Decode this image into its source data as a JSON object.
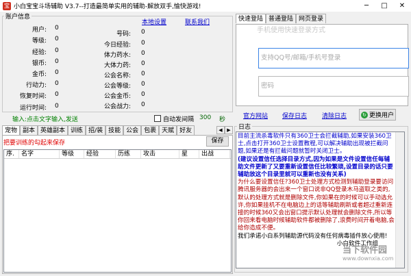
{
  "app": {
    "title": "小白宝宝斗场辅助 V3.7--打造最简单实用的辅助-解放双手,愉快游戏!",
    "icon_glyph": "宝"
  },
  "window_controls": {
    "min": "─",
    "max": "□",
    "close": "✕"
  },
  "account": {
    "legend": "账户信息",
    "links": {
      "local_settings": "本地设置",
      "contact_us": "联系我们"
    },
    "left": [
      {
        "label": "用户:",
        "value": "0"
      },
      {
        "label": "等级:",
        "value": "0"
      },
      {
        "label": "经验:",
        "value": "0"
      },
      {
        "label": "银币:",
        "value": "0"
      },
      {
        "label": "金币:",
        "value": "0"
      },
      {
        "label": "行动力:",
        "value": "0"
      },
      {
        "label": "恢复时间:",
        "value": "0"
      },
      {
        "label": "运行时间:",
        "value": "0"
      }
    ],
    "right": [
      {
        "label": "号码:",
        "value": "0"
      },
      {
        "label": "今日经验:",
        "value": "0"
      },
      {
        "label": "体力药水:",
        "value": "0"
      },
      {
        "label": "大体力药:",
        "value": "0"
      },
      {
        "label": "公会名称:",
        "value": "0"
      },
      {
        "label": "公会等级:",
        "value": "0"
      },
      {
        "label": "公会金币:",
        "value": "0"
      },
      {
        "label": "公会战力:",
        "value": "0"
      }
    ]
  },
  "input_hint": "输入:点击文字输入,发送",
  "auto_send": {
    "label": "自动发间隔",
    "value": "300",
    "unit": "秒"
  },
  "tabs": [
    "宠物",
    "副本",
    "英雄副本",
    "训练",
    "招/装",
    "技能",
    "公会",
    "包裹",
    "天赋",
    "好友"
  ],
  "tab_scroll": {
    "left": "◀",
    "right": "▶"
  },
  "warning": "把要训练的勾起来保存",
  "save_label": "保存",
  "grid_columns": [
    "序.",
    "名字",
    "等级",
    "经验",
    "历练",
    "攻击",
    "星",
    "出战"
  ],
  "login": {
    "tabs": [
      "快速登陆",
      "普通登陆",
      "网页登录"
    ],
    "active_tab": 0,
    "faded_banner": "手机使用快速登录方式",
    "account_placeholder": "支持QQ号/邮箱/手机号登录",
    "password_placeholder": "密码"
  },
  "actions": {
    "official_site": "官方网站",
    "save_log": "保存日志",
    "clear_log": "清除日志",
    "switch_user": "更换用户"
  },
  "log": {
    "legend": "日志",
    "paragraphs": [
      {
        "color": "#0000cc",
        "bold": false,
        "text": "目前主流杀毒软件只有360卫士会拦截辅助,如果安装360卫士,点击打开360卫士设置教程,可以解决辅助出现被拦截问题,如果还是有拦截问题就暂时关闭卫士。"
      },
      {
        "color": "#0000cc",
        "bold": true,
        "text": "(建议设置信任选择目录方式,因为如果是文件设置信任每辅助文件更新了又要重新设置信任比较繁琐,设置目录的话只要辅助放这个目录里就可以重新也没有关系)"
      },
      {
        "color": "#b00000",
        "bold": false,
        "text": "为什么要设置信任?360卫士处理方式检测到辅助登录要访问腾讯服务器的会出来一个窗口说非QQ登录木马盗取之类的,默认的处理方式就是删除文件,你如果在的时候可以手动选允许,你如果挂机不在电脑边上的话等辅助刷新或者超过重新连接的时候360又会出窗口提示默认处理就会删除文件,所以等你回来看电脑时候辅助软件都被删除了,浪费时间开着电脑,会给你造成不便。"
      },
      {
        "color": "#000000",
        "bold": false,
        "text": "我们承诺小白系列辅助源代码没有任何病毒插件放心使用!"
      }
    ],
    "signature": "小白软件工作组"
  },
  "watermark": {
    "title": "当下软件园",
    "subtitle": "www.downxia.com"
  }
}
